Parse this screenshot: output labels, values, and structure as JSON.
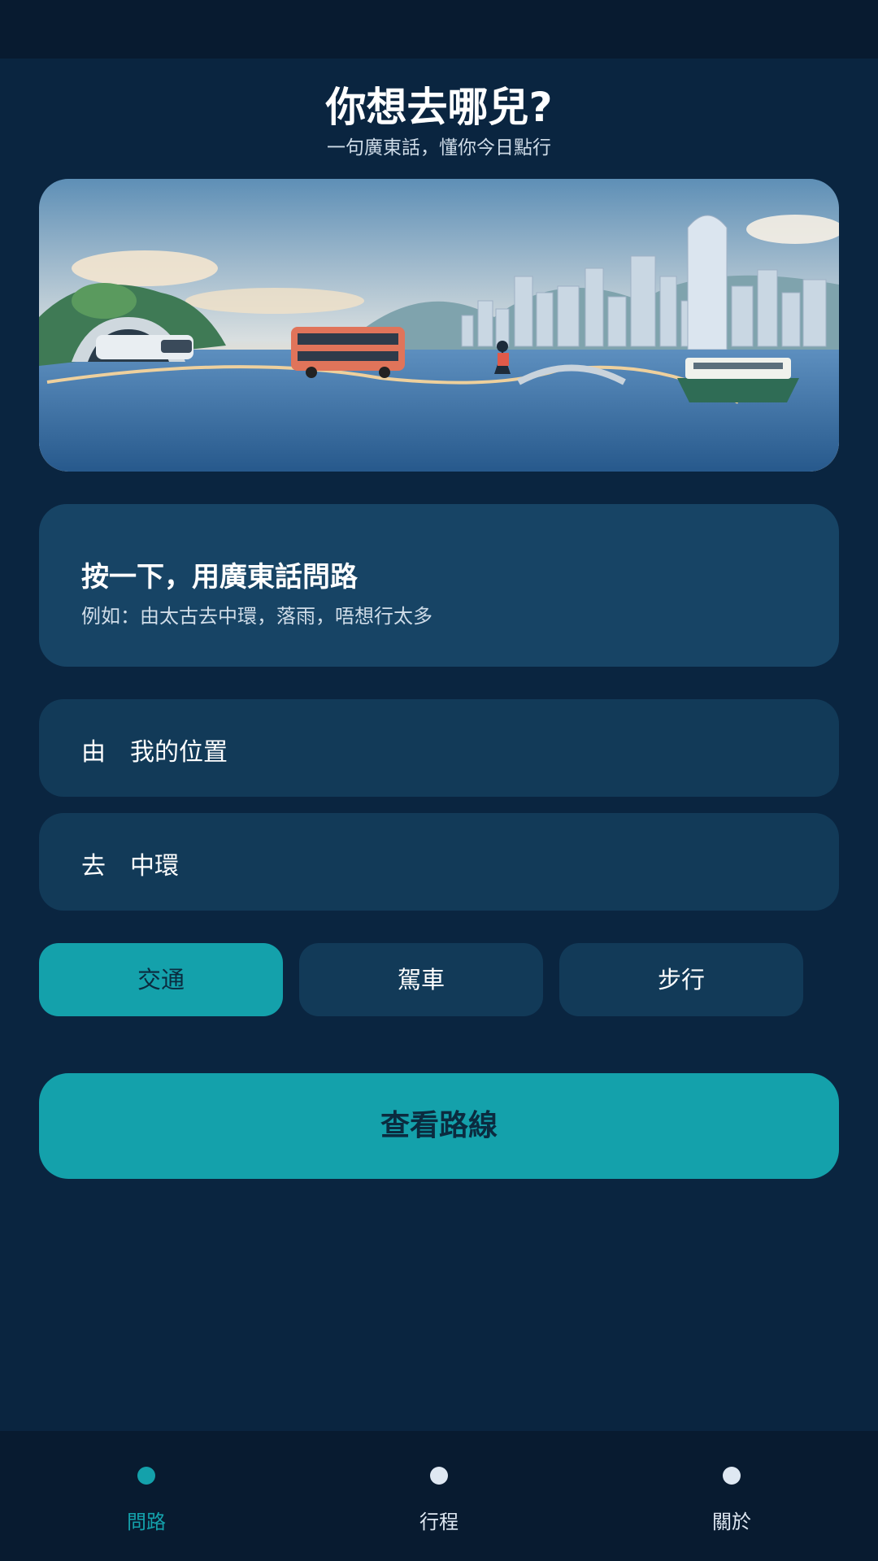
{
  "header": {
    "title": "你想去哪兒?",
    "subtitle": "一句廣東話，懂你今日點行"
  },
  "hero": {
    "illustration": "hong-kong-transit-skyline"
  },
  "voice": {
    "title": "按一下，用廣東話問路",
    "example": "例如：由太古去中環，落雨，唔想行太多"
  },
  "route": {
    "from_label": "由",
    "from_value": "我的位置",
    "to_label": "去",
    "to_value": "中環"
  },
  "modes": {
    "selected": "交通",
    "items": [
      "交通",
      "駕車",
      "步行"
    ]
  },
  "cta": {
    "label": "查看路線"
  },
  "nav": {
    "active": "問路",
    "items": [
      "問路",
      "行程",
      "關於"
    ]
  },
  "colors": {
    "background": "#0a2540",
    "card": "#174465",
    "field": "#123a58",
    "accent": "#14a1ab",
    "nav_bg": "#081b30"
  }
}
